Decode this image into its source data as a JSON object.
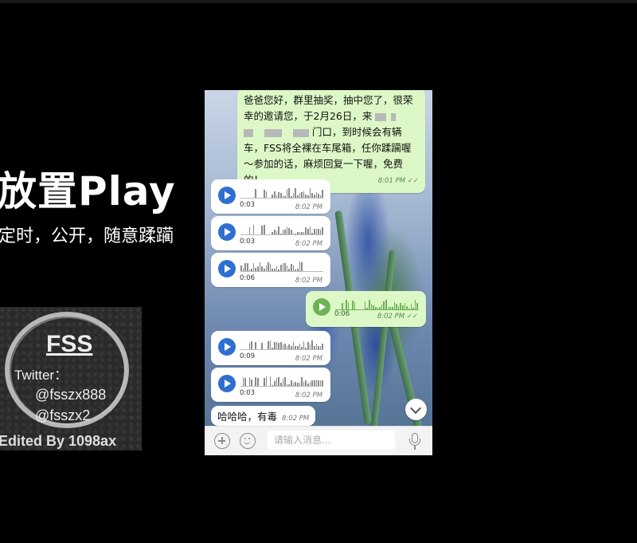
{
  "overlay": {
    "title": "放置Play",
    "subtitle": "定时，公开，随意蹂躏"
  },
  "logo": {
    "name": "FSS",
    "twitter_label": "Twitter：",
    "handle_1": "@fsszx888",
    "handle_2": "@fsszx2",
    "credit": "Edited By 1098ax"
  },
  "chat": {
    "first_message": {
      "line1": "爸爸您好，群里抽奖，抽中您了，很荣",
      "line2": "幸的邀请您，于2月26日，来",
      "line3_end": "门口，到时候会有辆",
      "line4": "车，FSS将全裸在车尾箱，任你蹂躏喔",
      "line5": "～参加的话，麻烦回复一下喔，免费",
      "line6": "的！",
      "time": "8:01 PM ✓✓",
      "direction": "outgoing"
    },
    "voice_messages": [
      {
        "duration": "0:03",
        "time": "8:02 PM",
        "direction": "incoming"
      },
      {
        "duration": "0:03",
        "time": "8:02 PM",
        "direction": "incoming"
      },
      {
        "duration": "0:06",
        "time": "8:02 PM",
        "direction": "incoming"
      },
      {
        "duration": "0:06",
        "time": "8:02 PM ✓✓",
        "direction": "outgoing"
      },
      {
        "duration": "0:09",
        "time": "8:02 PM",
        "direction": "incoming"
      },
      {
        "duration": "0:03",
        "time": "8:02 PM",
        "direction": "incoming"
      }
    ],
    "last_message": {
      "text": "哈哈哈，有毒",
      "time": "8:02 PM",
      "direction": "incoming"
    }
  },
  "input_bar": {
    "placeholder": "请输入消息..."
  },
  "icons": [
    "plus-icon",
    "emoji-icon",
    "microphone-icon",
    "play-icon",
    "chevron-down-icon"
  ],
  "colors": {
    "outgoing_bubble": "#dcf8c6",
    "incoming_bubble": "#ffffff",
    "incoming_play": "#2f6fcf",
    "outgoing_play": "#6fb255"
  }
}
